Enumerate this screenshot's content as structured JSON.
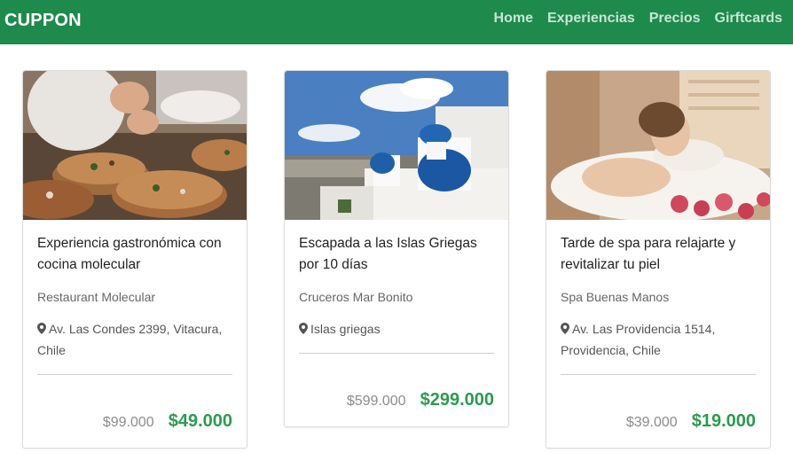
{
  "brand": "CUPPON",
  "nav": {
    "home": "Home",
    "experiences": "Experiencias",
    "prices": "Precios",
    "giftcards": "Girftcards"
  },
  "colors": {
    "navbar": "#1e8a4c",
    "price_accent": "#2e9a4f"
  },
  "cards": [
    {
      "title": "Experiencia gastronómica con cocina molecular",
      "provider": "Restaurant Molecular",
      "location_icon": "map-pin-icon",
      "location": "Av. Las Condes 2399, Vitacura, Chile",
      "old_price": "$99.000",
      "price": "$49.000",
      "image": "photo-molecular-cuisine"
    },
    {
      "title": "Escapada a las Islas Griegas por 10 días",
      "provider": "Cruceros Mar Bonito",
      "location_icon": "map-pin-icon",
      "location": "Islas griegas",
      "old_price": "$599.000",
      "price": "$299.000",
      "image": "photo-santorini"
    },
    {
      "title": "Tarde de spa para relajarte y revitalizar tu piel",
      "provider": "Spa Buenas Manos",
      "location_icon": "map-pin-icon",
      "location": "Av. Las Providencia 1514, Providencia, Chile",
      "old_price": "$39.000",
      "price": "$19.000",
      "image": "photo-spa"
    }
  ]
}
